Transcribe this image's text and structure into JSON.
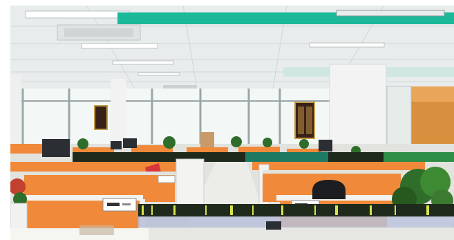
{
  "image": {
    "scene": "open-plan-office",
    "palette": {
      "ceiling": "#e9ecec",
      "ceiling_shadow": "#d7dcdc",
      "window_light": "#f3f7f6",
      "window_frame": "#9aa7a8",
      "partition_orange": "#f08a3a",
      "partition_shadow": "#d86f24",
      "desk_white": "#f5f5f2",
      "floor": "#e2e2de",
      "glitch_teal": "#1bb99a",
      "glitch_dark": "#1f2a1c",
      "plant_green": "#2f6d2a",
      "wood_door": "#d8903e",
      "banner_dark": "#3a2118",
      "banner_gold": "#c59a46",
      "monitor": "#2b2e32",
      "red_flag": "#d8363b"
    },
    "icons": [
      "ceiling-light-icon",
      "plant-icon",
      "monitor-icon",
      "chair-icon",
      "nameplate-icon",
      "banner-icon"
    ]
  }
}
